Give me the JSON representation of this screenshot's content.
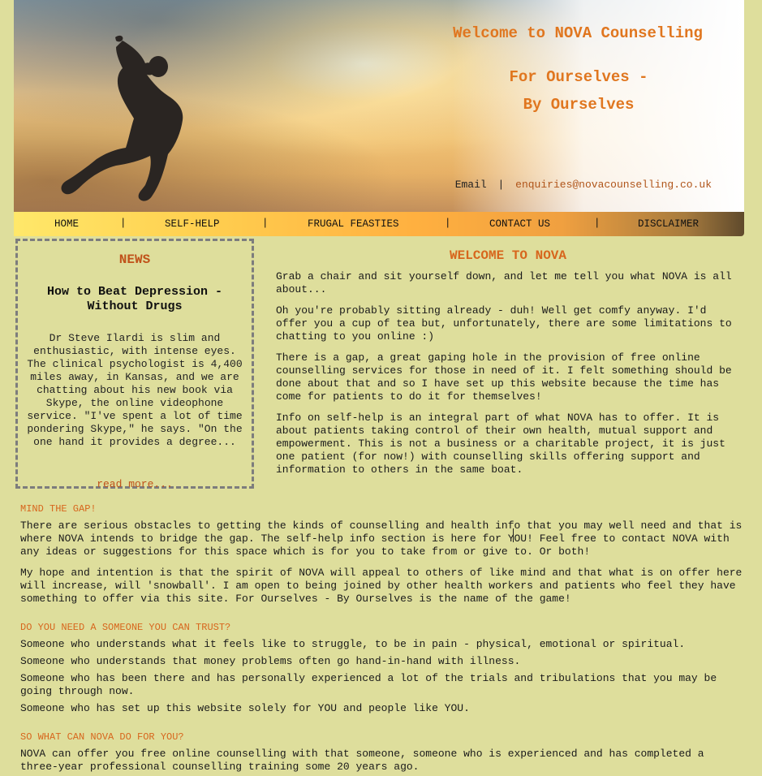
{
  "header": {
    "welcome": "Welcome to NOVA Counselling",
    "tagline_1": "For Ourselves -",
    "tagline_2": "By Ourselves",
    "email_label": "Email",
    "email_sep": "|",
    "email_address": "enquiries@novacounselling.co.uk"
  },
  "nav": {
    "items": [
      "HOME",
      "SELF-HELP",
      "FRUGAL FEASTIES",
      "CONTACT US",
      "DISCLAIMER"
    ],
    "separator": "|"
  },
  "news": {
    "title": "NEWS",
    "headline": "How to Beat Depression - Without Drugs",
    "body": "Dr Steve Ilardi is slim and enthusiastic, with intense eyes. The clinical psychologist is 4,400 miles away, in Kansas, and we are chatting about his new book via Skype, the online videophone service. \"I've spent a lot of time pondering Skype,\" he says. \"On the one hand it provides a degree...",
    "read_more": "read more..."
  },
  "welcome": {
    "title": "WELCOME TO NOVA",
    "paragraphs": [
      "Grab a chair and sit yourself down, and let me tell you what NOVA is all about...",
      "Oh you're probably sitting already - duh! Well get comfy anyway. I'd offer you a cup of tea but, unfortunately, there are some limitations to chatting to you online :)",
      "There is a gap, a great gaping hole in the provision of free online counselling services for those in need of it. I felt something should be done about that and so I have set up this website because the time has come for patients to do it for themselves!",
      "Info on self-help is an integral part of what NOVA has to offer. It is about patients taking control of their own health, mutual support and empowerment. This is not a business or a charitable project, it is just one patient (for now!) with counselling skills offering support and information to others in the same boat."
    ]
  },
  "mind_gap": {
    "heading": "MIND THE GAP!",
    "paragraphs": [
      "There are serious obstacles to getting the kinds of counselling and health info that you may well need and that is where NOVA intends to bridge the gap. The self-help info section is here for YOU! Feel free to contact NOVA with any ideas or suggestions for this space which is for you to take from or give to. Or both!",
      "My hope and intention is that the spirit of NOVA will appeal to others of like mind and that what is on offer here will increase, will 'snowball'. I am open to being joined by other health workers and patients who feel they have something to offer via this site. For Ourselves - By Ourselves is the name of the game!"
    ]
  },
  "trust": {
    "heading": "DO YOU NEED A SOMEONE YOU CAN TRUST?",
    "paragraphs": [
      "Someone who understands what it feels like to struggle, to be in pain - physical, emotional or spiritual.",
      "Someone who understands that money problems often go hand-in-hand with illness.",
      "Someone who has been there and has personally experienced a lot of the trials and tribulations that you may be going through now.",
      "Someone who has set up this website solely for YOU and people like YOU."
    ]
  },
  "what_can": {
    "heading": "SO WHAT CAN NOVA DO FOR YOU?",
    "paragraphs": [
      "NOVA can offer you free online counselling with that someone, someone who is experienced and has completed a three-year professional counselling training some 20 years ago."
    ]
  },
  "colors": {
    "page_bg": "#dede9c",
    "accent_orange": "#d7661d",
    "link_rust": "#c0521a",
    "news_border": "#7d7d7d"
  }
}
